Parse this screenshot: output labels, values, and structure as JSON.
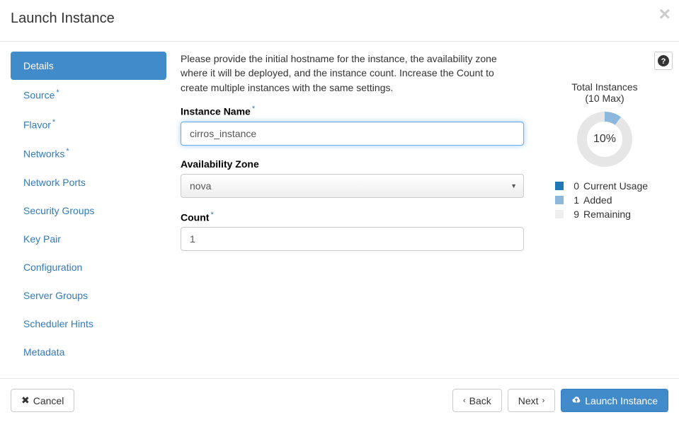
{
  "header": {
    "title": "Launch Instance"
  },
  "sidebar": {
    "items": [
      {
        "label": "Details",
        "required": false,
        "active": true
      },
      {
        "label": "Source",
        "required": true,
        "active": false
      },
      {
        "label": "Flavor",
        "required": true,
        "active": false
      },
      {
        "label": "Networks",
        "required": true,
        "active": false
      },
      {
        "label": "Network Ports",
        "required": false,
        "active": false
      },
      {
        "label": "Security Groups",
        "required": false,
        "active": false
      },
      {
        "label": "Key Pair",
        "required": false,
        "active": false
      },
      {
        "label": "Configuration",
        "required": false,
        "active": false
      },
      {
        "label": "Server Groups",
        "required": false,
        "active": false
      },
      {
        "label": "Scheduler Hints",
        "required": false,
        "active": false
      },
      {
        "label": "Metadata",
        "required": false,
        "active": false
      }
    ]
  },
  "form": {
    "description": "Please provide the initial hostname for the instance, the availability zone where it will be deployed, and the instance count. Increase the Count to create multiple instances with the same settings.",
    "instance_name_label": "Instance Name",
    "instance_name_value": "cirros_instance",
    "availability_zone_label": "Availability Zone",
    "availability_zone_value": "nova",
    "count_label": "Count",
    "count_value": "1"
  },
  "quota": {
    "title": "Total Instances",
    "subtitle": "(10 Max)",
    "percent_text": "10%",
    "percent": 10,
    "legend": [
      {
        "num": "0",
        "label": "Current Usage",
        "color": "#1f77b4"
      },
      {
        "num": "1",
        "label": "Added",
        "color": "#8cb8dc"
      },
      {
        "num": "9",
        "label": "Remaining",
        "color": "#eeeeee"
      }
    ]
  },
  "footer": {
    "cancel": "Cancel",
    "back": "Back",
    "next": "Next",
    "launch": "Launch Instance"
  }
}
